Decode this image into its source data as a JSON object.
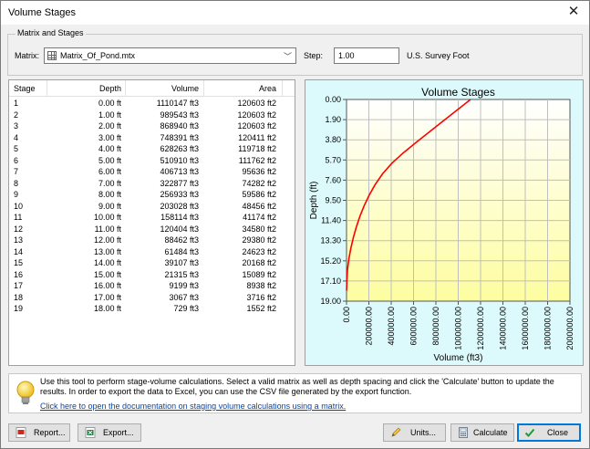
{
  "window": {
    "title": "Volume Stages"
  },
  "matrix_group": {
    "legend": "Matrix and Stages",
    "matrix_label": "Matrix:",
    "matrix_value": "Matrix_Of_Pond.mtx",
    "step_label": "Step:",
    "step_value": "1.00",
    "unit_label": "U.S. Survey Foot"
  },
  "table": {
    "columns": [
      "Stage",
      "Depth",
      "Volume",
      "Area"
    ],
    "rows": [
      [
        "1",
        "0.00 ft",
        "1110147 ft3",
        "120603 ft2"
      ],
      [
        "2",
        "1.00 ft",
        "989543 ft3",
        "120603 ft2"
      ],
      [
        "3",
        "2.00 ft",
        "868940 ft3",
        "120603 ft2"
      ],
      [
        "4",
        "3.00 ft",
        "748391 ft3",
        "120411 ft2"
      ],
      [
        "5",
        "4.00 ft",
        "628263 ft3",
        "119718 ft2"
      ],
      [
        "6",
        "5.00 ft",
        "510910 ft3",
        "111762 ft2"
      ],
      [
        "7",
        "6.00 ft",
        "406713 ft3",
        "95636 ft2"
      ],
      [
        "8",
        "7.00 ft",
        "322877 ft3",
        "74282 ft2"
      ],
      [
        "9",
        "8.00 ft",
        "256933 ft3",
        "59586 ft2"
      ],
      [
        "10",
        "9.00 ft",
        "203028 ft3",
        "48456 ft2"
      ],
      [
        "11",
        "10.00 ft",
        "158114 ft3",
        "41174 ft2"
      ],
      [
        "12",
        "11.00 ft",
        "120404 ft3",
        "34580 ft2"
      ],
      [
        "13",
        "12.00 ft",
        "88462 ft3",
        "29380 ft2"
      ],
      [
        "14",
        "13.00 ft",
        "61484 ft3",
        "24623 ft2"
      ],
      [
        "15",
        "14.00 ft",
        "39107 ft3",
        "20168 ft2"
      ],
      [
        "16",
        "15.00 ft",
        "21315 ft3",
        "15089 ft2"
      ],
      [
        "17",
        "16.00 ft",
        "9199 ft3",
        "8938 ft2"
      ],
      [
        "18",
        "17.00 ft",
        "3067 ft3",
        "3716 ft2"
      ],
      [
        "19",
        "18.00 ft",
        "729 ft3",
        "1552 ft2"
      ]
    ]
  },
  "chart_data": {
    "type": "line",
    "title": "Volume Stages",
    "xlabel": "Volume (ft3)",
    "ylabel": "Depth (ft)",
    "xlim": [
      0,
      2000000
    ],
    "ylim": [
      19,
      0
    ],
    "y_inverted": true,
    "x_ticks": [
      "0.00",
      "200000.00",
      "400000.00",
      "600000.00",
      "800000.00",
      "1000000.00",
      "1200000.00",
      "1400000.00",
      "1600000.00",
      "1800000.00",
      "2000000.00"
    ],
    "y_ticks": [
      "0.00",
      "1.90",
      "3.80",
      "5.70",
      "7.60",
      "9.50",
      "11.40",
      "13.30",
      "15.20",
      "17.10",
      "19.00"
    ],
    "grid": true,
    "series": [
      {
        "color": "#ff0000",
        "x": [
          1110147,
          989543,
          868940,
          748391,
          628263,
          510910,
          406713,
          322877,
          256933,
          203028,
          158114,
          120404,
          88462,
          61484,
          39107,
          21315,
          9199,
          3067,
          729
        ],
        "y": [
          0,
          1,
          2,
          3,
          4,
          5,
          6,
          7,
          8,
          9,
          10,
          11,
          12,
          13,
          14,
          15,
          16,
          17,
          18
        ]
      }
    ],
    "background_top": "#ffffff",
    "background_bottom": "#fdfda0",
    "panel_color": "#dcfafc"
  },
  "info": {
    "text": "Use this tool to perform stage-volume calculations. Select a valid matrix as well as depth spacing and click the 'Calculate' button to update the results. In order to export the data to Excel, you can use the CSV file generated by the export function.",
    "link": "Click here to open the documentation on staging volume calculations using a matrix."
  },
  "buttons": {
    "report": "Report...",
    "export": "Export...",
    "units": "Units...",
    "calculate": "Calculate",
    "close": "Close"
  },
  "colors": {
    "accent": "#0078d7",
    "link": "#0645ad"
  }
}
